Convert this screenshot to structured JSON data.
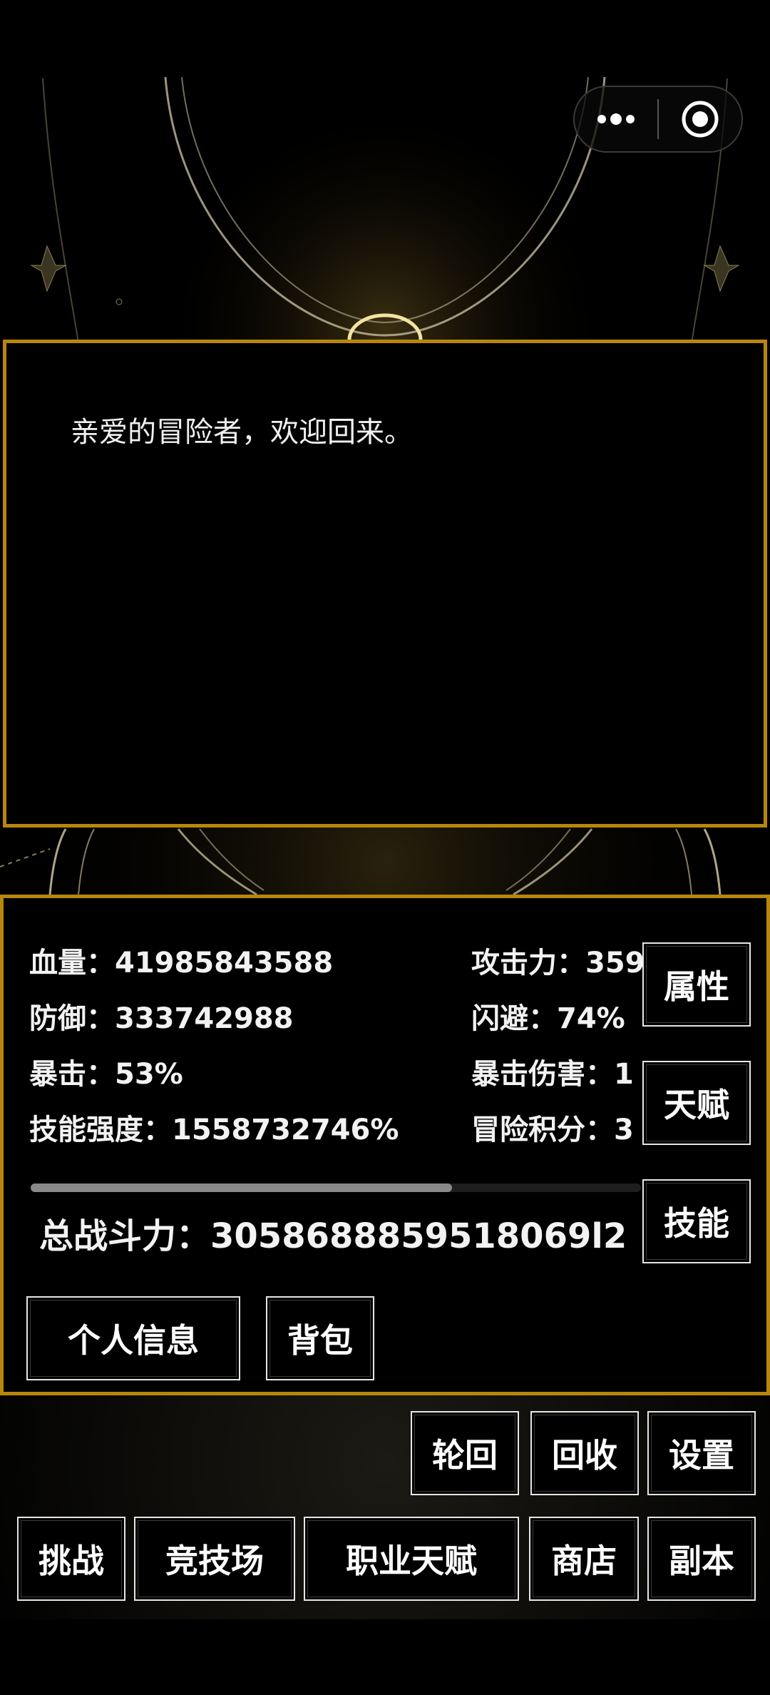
{
  "capsule": {
    "more_icon": "more-dots-icon",
    "close_icon": "target-circle-icon"
  },
  "message": {
    "text": "亲爱的冒险者，欢迎回来。"
  },
  "stats": {
    "hp": "血量：41985843588",
    "defense": "防御：333742988",
    "crit": "暴击：53%",
    "skill_power": "技能强度：1558732746%",
    "attack": "攻击力：359",
    "dodge": "闪避：74%",
    "crit_damage": "暴击伤害：1",
    "adventure_points": "冒险积分：3",
    "progress": 0.69,
    "total_power": "总战斗力：3058688859518069l2"
  },
  "side_buttons": {
    "attributes": "属性",
    "talent": "天赋",
    "skills": "技能"
  },
  "panel_buttons": {
    "profile": "个人信息",
    "bag": "背包"
  },
  "row1": {
    "reincarnation": "轮回",
    "recycle": "回收",
    "settings": "设置"
  },
  "row2": {
    "challenge": "挑战",
    "arena": "竞技场",
    "class_talent": "职业天赋",
    "shop": "商店",
    "dungeon": "副本"
  },
  "colors": {
    "accent": "#b8860b",
    "background": "#000000"
  }
}
